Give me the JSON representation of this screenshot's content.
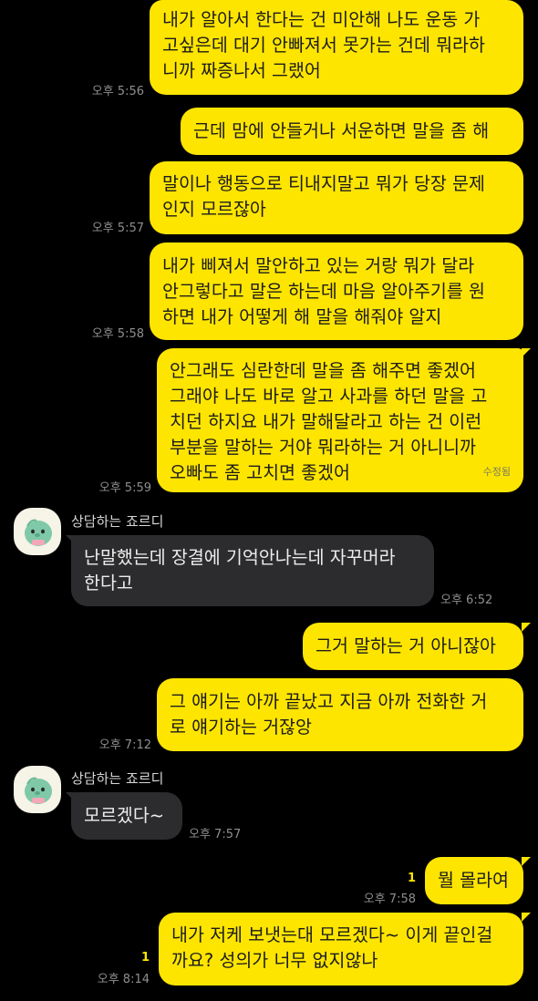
{
  "colors": {
    "my_bubble": "#fee500",
    "their_bubble": "#2c2c2e",
    "background": "#000000",
    "unread": "#fee500"
  },
  "messages": [
    {
      "side": "mine",
      "lines": [
        "내가 알아서 한다는 건 미안해 나도 운동 가",
        "고싶은데 대기 안빠져서 못가는 건데 뭐라하",
        "니까 짜증나서 그랬어"
      ],
      "time": "오후 5:56"
    },
    {
      "side": "mine",
      "lines": [
        "근데 맘에 안들거나 서운하면 말을 좀 해"
      ]
    },
    {
      "side": "mine",
      "lines": [
        "말이나 행동으로 티내지말고 뭐가 당장 문제",
        "인지 모르잖아"
      ],
      "time": "오후 5:57"
    },
    {
      "side": "mine",
      "lines": [
        "내가 삐져서 말안하고 있는 거랑 뭐가 달라",
        "안그렇다고 말은 하는데 마음 알아주기를 원",
        "하면 내가 어떻게 해 말을 해줘야 알지"
      ],
      "time": "오후 5:58"
    },
    {
      "side": "mine",
      "lines": [
        "안그래도 심란한데 말을 좀 해주면 좋겠어",
        "그래야 나도 바로 알고 사과를 하던 말을 고",
        "치던 하지요 내가 말해달라고 하는 건 이런",
        "부분을 말하는 거야 뭐라하는 거 아니니까",
        "오빠도 좀 고치면 좋겠어"
      ],
      "time": "오후 5:59",
      "edited": "수정됨"
    },
    {
      "side": "theirs",
      "sender": "상담하는 죠르디",
      "lines": [
        "난말했는데 장결에 기억안나는데 자꾸머라",
        "한다고"
      ],
      "time": "오후 6:52"
    },
    {
      "side": "mine",
      "lines": [
        "그거 말하는 거 아니잖아"
      ]
    },
    {
      "side": "mine",
      "lines": [
        "그 얘기는 아까 끝났고 지금 아까 전화한 거",
        "로 얘기하는 거잖앙"
      ],
      "time": "오후 7:12"
    },
    {
      "side": "theirs",
      "sender": "상담하는 죠르디",
      "lines": [
        "모르겠다~"
      ],
      "time": "오후 7:57"
    },
    {
      "side": "mine",
      "lines": [
        "뭘 몰라여"
      ],
      "time": "오후 7:58",
      "unread": "1"
    },
    {
      "side": "mine",
      "lines": [
        "내가 저케 보냇는대 모르겠다~ 이게 끝인걸",
        "까요? 성의가 너무 없지않나"
      ],
      "time": "오후 8:14",
      "unread": "1"
    }
  ]
}
